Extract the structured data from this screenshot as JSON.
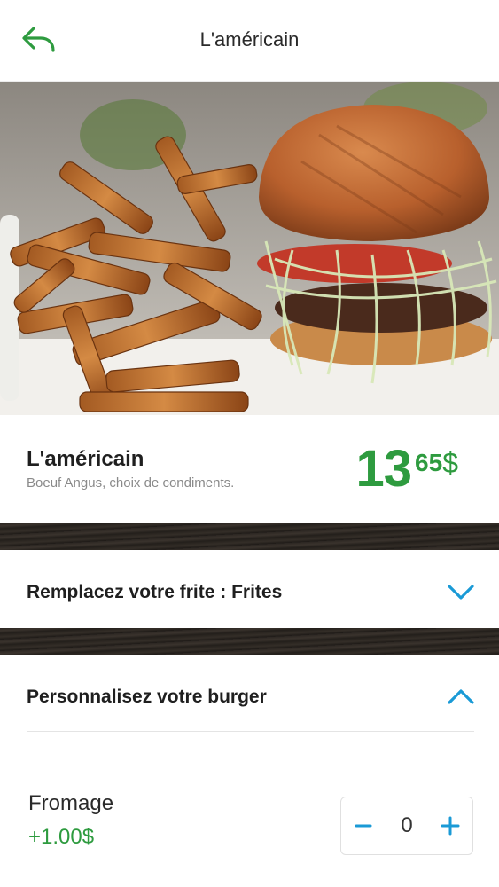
{
  "header": {
    "title": "L'américain",
    "back_icon": "back-arrow-icon"
  },
  "product": {
    "name": "L'américain",
    "description": "Boeuf Angus, choix de condiments.",
    "price_int": "13",
    "price_cents": "65",
    "currency": "$"
  },
  "sections": {
    "fries": {
      "label": "Remplacez votre frite : Frites",
      "state": "collapsed",
      "icon": "chevron-down-icon"
    },
    "custom": {
      "label": "Personnalisez votre burger",
      "state": "expanded",
      "icon": "chevron-up-icon"
    }
  },
  "options": [
    {
      "name": "Fromage",
      "price": "+1.00$",
      "quantity": "0"
    }
  ],
  "colors": {
    "accent_green": "#2e9b3f",
    "accent_blue": "#1a9ad6"
  }
}
